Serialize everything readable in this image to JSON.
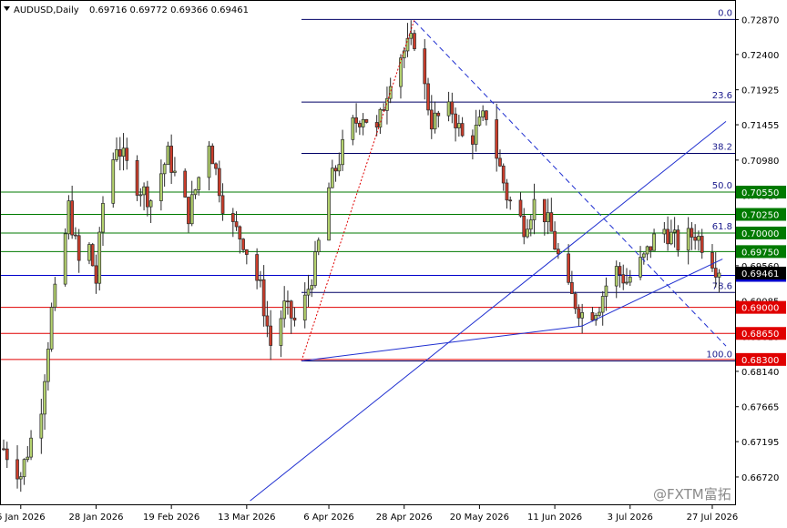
{
  "header": {
    "symbol": "AUDUSD,Daily",
    "ohlc": "0.69716 0.69772 0.69366 0.69461",
    "icon": "triangle-down-icon"
  },
  "watermark": "@FXTM富拓",
  "colors": {
    "bull": "#b4d26e",
    "bear": "#cc3d2b",
    "wick": "#2b2b2b",
    "support": "#e00000",
    "resistance": "#007a00",
    "fib": "#000066",
    "current": "#0000cc",
    "trend": "#1f2fd0",
    "grid": "#c8c8c8"
  },
  "chart_data": {
    "type": "candlestick",
    "symbol": "AUDUSD",
    "timeframe": "Daily",
    "ylim": [
      0.6634,
      0.7312
    ],
    "y_ticks": [
      "0.72870",
      "0.72400",
      "0.71925",
      "0.71455",
      "0.70980",
      "0.70510",
      "0.70035",
      "0.69560",
      "0.69085",
      "0.68610",
      "0.68140",
      "0.67665",
      "0.67195",
      "0.66720"
    ],
    "x_ticks": [
      {
        "label": "6 Jan 2026",
        "date": "2026-01-06"
      },
      {
        "label": "28 Jan 2026",
        "date": "2026-01-28"
      },
      {
        "label": "19 Feb 2026",
        "date": "2026-02-19"
      },
      {
        "label": "13 Mar 2026",
        "date": "2026-03-13"
      },
      {
        "label": "6 Apr 2026",
        "date": "2026-04-06"
      },
      {
        "label": "28 Apr 2026",
        "date": "2026-04-28"
      },
      {
        "label": "20 May 2026",
        "date": "2026-05-20"
      },
      {
        "label": "11 Jun 2026",
        "date": "2026-06-11"
      },
      {
        "label": "3 Jul 2026",
        "date": "2026-07-03"
      },
      {
        "label": "27 Jul 2026",
        "date": "2026-07-27"
      }
    ],
    "anchors": [
      {
        "date": "2026-01-01",
        "price": 0.671
      },
      {
        "date": "2026-01-06",
        "price": 0.6675
      },
      {
        "date": "2026-01-12",
        "price": 0.677
      },
      {
        "date": "2026-01-15",
        "price": 0.6895
      },
      {
        "date": "2026-01-18",
        "price": 0.696
      },
      {
        "date": "2026-01-20",
        "price": 0.7035
      },
      {
        "date": "2026-01-23",
        "price": 0.696
      },
      {
        "date": "2026-01-26",
        "price": 0.698
      },
      {
        "date": "2026-01-28",
        "price": 0.6935
      },
      {
        "date": "2026-01-30",
        "price": 0.704
      },
      {
        "date": "2026-02-03",
        "price": 0.712
      },
      {
        "date": "2026-02-08",
        "price": 0.707
      },
      {
        "date": "2026-02-13",
        "price": 0.7045
      },
      {
        "date": "2026-02-18",
        "price": 0.7105
      },
      {
        "date": "2026-02-24",
        "price": 0.7025
      },
      {
        "date": "2026-03-02",
        "price": 0.7125
      },
      {
        "date": "2026-03-07",
        "price": 0.702
      },
      {
        "date": "2026-03-12",
        "price": 0.699
      },
      {
        "date": "2026-03-17",
        "price": 0.6925
      },
      {
        "date": "2026-03-20",
        "price": 0.685
      },
      {
        "date": "2026-03-24",
        "price": 0.69
      },
      {
        "date": "2026-03-28",
        "price": 0.6875
      },
      {
        "date": "2026-04-02",
        "price": 0.696
      },
      {
        "date": "2026-04-06",
        "price": 0.706
      },
      {
        "date": "2026-04-12",
        "price": 0.714
      },
      {
        "date": "2026-04-16",
        "price": 0.716
      },
      {
        "date": "2026-04-20",
        "price": 0.7135
      },
      {
        "date": "2026-04-25",
        "price": 0.723
      },
      {
        "date": "2026-05-01",
        "price": 0.726
      },
      {
        "date": "2026-05-06",
        "price": 0.715
      },
      {
        "date": "2026-05-12",
        "price": 0.7165
      },
      {
        "date": "2026-05-16",
        "price": 0.7115
      },
      {
        "date": "2026-05-22",
        "price": 0.716
      },
      {
        "date": "2026-05-28",
        "price": 0.705
      },
      {
        "date": "2026-06-02",
        "price": 0.701
      },
      {
        "date": "2026-06-06",
        "price": 0.705
      },
      {
        "date": "2026-06-10",
        "price": 0.7
      },
      {
        "date": "2026-06-15",
        "price": 0.692
      },
      {
        "date": "2026-06-20",
        "price": 0.6885
      },
      {
        "date": "2026-06-24",
        "price": 0.6905
      },
      {
        "date": "2026-06-28",
        "price": 0.6955
      },
      {
        "date": "2026-07-02",
        "price": 0.6935
      },
      {
        "date": "2026-07-07",
        "price": 0.6965
      },
      {
        "date": "2026-07-12",
        "price": 0.701
      },
      {
        "date": "2026-07-17",
        "price": 0.6985
      },
      {
        "date": "2026-07-22",
        "price": 0.7
      },
      {
        "date": "2026-07-27",
        "price": 0.6965
      },
      {
        "date": "2026-07-29",
        "price": 0.6946
      }
    ],
    "fib_levels": [
      {
        "label": "0.0",
        "price": 0.7287
      },
      {
        "label": "23.6",
        "price": 0.7176
      },
      {
        "label": "38.2",
        "price": 0.7107
      },
      {
        "label": "50.0",
        "price": 0.7055
      },
      {
        "label": "61.8",
        "price": 0.7
      },
      {
        "label": "78.6",
        "price": 0.692
      },
      {
        "label": "100.0",
        "price": 0.6828
      }
    ],
    "horizontal_levels": [
      {
        "price_label": "0.70550",
        "price": 0.7055,
        "kind": "resistance"
      },
      {
        "price_label": "0.70250",
        "price": 0.7025,
        "kind": "resistance"
      },
      {
        "price_label": "0.70000",
        "price": 0.7,
        "kind": "resistance"
      },
      {
        "price_label": "0.69750",
        "price": 0.6975,
        "kind": "resistance"
      },
      {
        "price_label": "0.69430",
        "price": 0.6943,
        "kind": "current"
      },
      {
        "price_label": "0.69000",
        "price": 0.69,
        "kind": "support"
      },
      {
        "price_label": "0.68650",
        "price": 0.6865,
        "kind": "support"
      },
      {
        "price_label": "0.68300",
        "price": 0.683,
        "kind": "support"
      }
    ],
    "last_price_label": "0.69461",
    "last_price": 0.69461
  }
}
